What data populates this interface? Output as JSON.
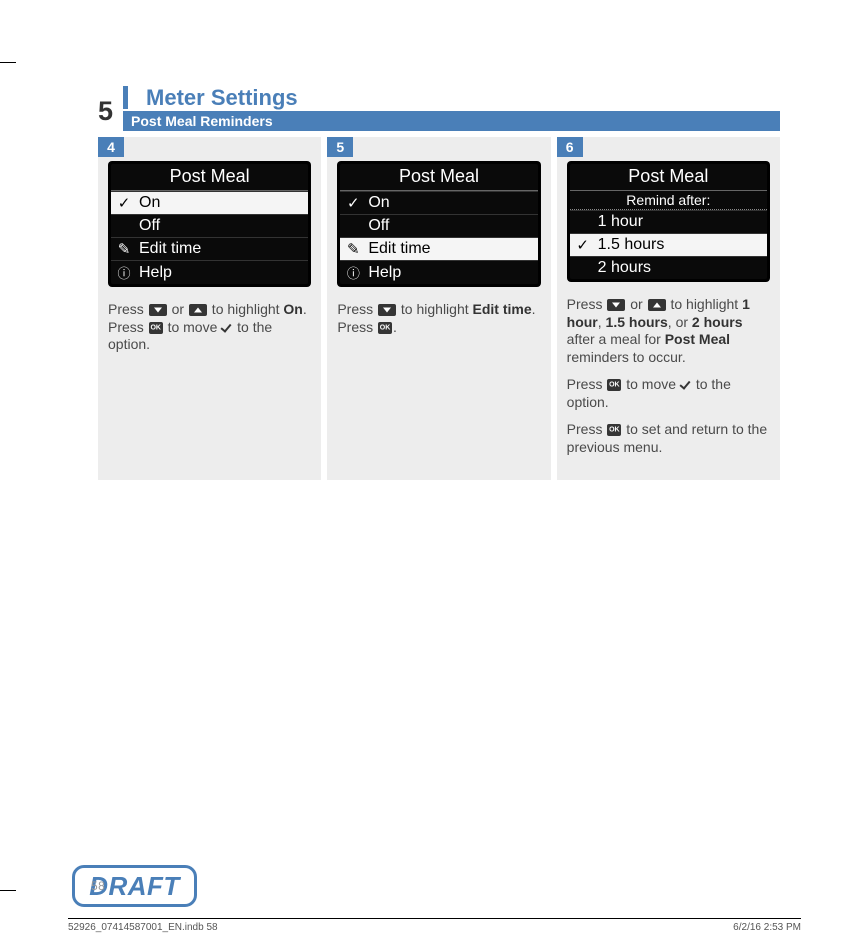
{
  "header": {
    "section_number": "5",
    "title": "Meter Settings",
    "subtitle": "Post Meal Reminders"
  },
  "steps": [
    {
      "num": "4",
      "screen": {
        "title": "Post Meal",
        "rows": [
          {
            "icon": "check",
            "label": "On",
            "selected": true
          },
          {
            "icon": "",
            "label": "Off",
            "selected": false
          },
          {
            "icon": "pencil",
            "label": "Edit time",
            "selected": false
          },
          {
            "icon": "help",
            "label": "Help",
            "selected": false
          }
        ]
      },
      "instr_parts": {
        "p1_a": "Press ",
        "p1_b": " or ",
        "p1_c": " to highlight ",
        "p1_bold": "On",
        "p1_d": ". Press ",
        "p1_e": " to move ",
        "p1_f": " to the option."
      }
    },
    {
      "num": "5",
      "screen": {
        "title": "Post Meal",
        "rows": [
          {
            "icon": "check",
            "label": "On",
            "selected": false
          },
          {
            "icon": "",
            "label": "Off",
            "selected": false
          },
          {
            "icon": "pencil",
            "label": "Edit time",
            "selected": true
          },
          {
            "icon": "help",
            "label": "Help",
            "selected": false
          }
        ]
      },
      "instr_parts": {
        "p1_a": "Press ",
        "p1_b": " to highlight ",
        "p1_bold": "Edit time",
        "p1_c": ". Press ",
        "p1_d": "."
      }
    },
    {
      "num": "6",
      "screen": {
        "title": "Post Meal",
        "sub": "Remind after:",
        "rows": [
          {
            "icon": "",
            "label": "1 hour",
            "selected": false
          },
          {
            "icon": "check",
            "label": "1.5 hours",
            "selected": true
          },
          {
            "icon": "",
            "label": "2 hours",
            "selected": false
          }
        ]
      },
      "instr_parts": {
        "p1_a": "Press ",
        "p1_b": " or ",
        "p1_c": " to highlight ",
        "p1_bold1": "1 hour",
        "p1_sep1": ", ",
        "p1_bold2": "1.5 hours",
        "p1_sep2": ", or ",
        "p1_bold3": "2 hours",
        "p1_d": " after a meal for ",
        "p1_bold4": "Post Meal",
        "p1_e": " reminders to occur.",
        "p2_a": "Press ",
        "p2_b": " to move ",
        "p2_c": " to the option.",
        "p3_a": "Press ",
        "p3_b": " to set and return to the previous menu."
      }
    }
  ],
  "draft": {
    "label": "DRAFT",
    "page_num": "58"
  },
  "footer": {
    "left": "52926_07414587001_EN.indb   58",
    "right": "6/2/16   2:53 PM"
  }
}
